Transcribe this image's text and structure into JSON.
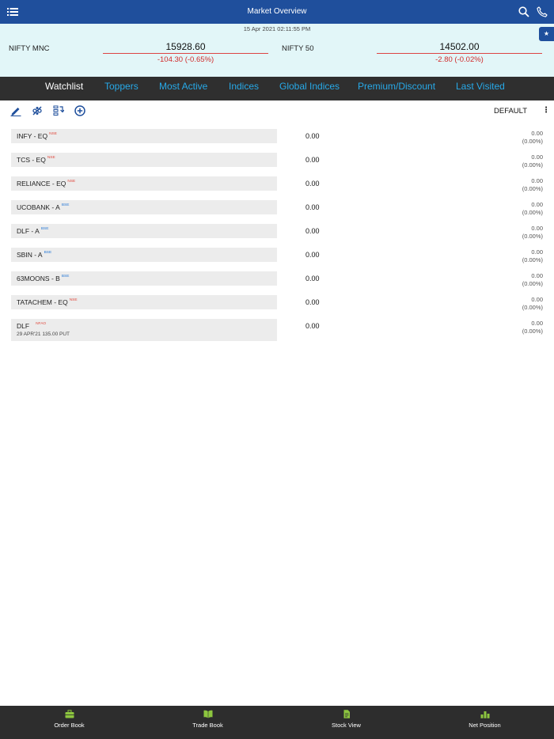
{
  "header": {
    "title": "Market Overview",
    "menu_icon": "hamburger-menu-icon",
    "search_icon": "search-icon",
    "phone_icon": "phone-icon"
  },
  "market": {
    "timestamp": "15 Apr 2021 02:11:55 PM",
    "indices": [
      {
        "name": "NIFTY MNC",
        "value": "15928.60",
        "change": "-104.30 (-0.65%)"
      },
      {
        "name": "NIFTY 50",
        "value": "14502.00",
        "change": "-2.80 (-0.02%)"
      }
    ],
    "favorite_icon": "star-icon"
  },
  "tabs": [
    {
      "label": "Watchlist",
      "active": true
    },
    {
      "label": "Toppers",
      "active": false
    },
    {
      "label": "Most Active",
      "active": false
    },
    {
      "label": "Indices",
      "active": false
    },
    {
      "label": "Global Indices",
      "active": false
    },
    {
      "label": "Premium/Discount",
      "active": false
    },
    {
      "label": "Last Visited",
      "active": false
    }
  ],
  "toolbar": {
    "icons": [
      "edit-icon",
      "reorder-icon",
      "sort-icon",
      "add-circle-icon"
    ],
    "watchlist_name": "DEFAULT",
    "more_icon": "kebab-menu-icon"
  },
  "watchlist": [
    {
      "symbol": "INFY",
      "series": " - EQ",
      "exchange": "NSE",
      "ltp": "0.00",
      "change": "0.00",
      "change_pct": "(0.00%)"
    },
    {
      "symbol": "TCS",
      "series": " - EQ",
      "exchange": "NSE",
      "ltp": "0.00",
      "change": "0.00",
      "change_pct": "(0.00%)"
    },
    {
      "symbol": "RELIANCE",
      "series": " - EQ",
      "exchange": "NSE",
      "ltp": "0.00",
      "change": "0.00",
      "change_pct": "(0.00%)"
    },
    {
      "symbol": "UCOBANK",
      "series": " - A",
      "exchange": "BSE",
      "ltp": "0.00",
      "change": "0.00",
      "change_pct": "(0.00%)"
    },
    {
      "symbol": "DLF",
      "series": " - A",
      "exchange": "BSE",
      "ltp": "0.00",
      "change": "0.00",
      "change_pct": "(0.00%)"
    },
    {
      "symbol": "SBIN",
      "series": " - A",
      "exchange": "BSE",
      "ltp": "0.00",
      "change": "0.00",
      "change_pct": "(0.00%)"
    },
    {
      "symbol": "63MOONS",
      "series": " - B",
      "exchange": "BSE",
      "ltp": "0.00",
      "change": "0.00",
      "change_pct": "(0.00%)"
    },
    {
      "symbol": "TATACHEM",
      "series": " - EQ",
      "exchange": "NSE",
      "ltp": "0.00",
      "change": "0.00",
      "change_pct": "(0.00%)"
    },
    {
      "symbol": "DLF",
      "series": "",
      "exchange": "NFAO",
      "contract": "29 APR'21 135.00 PUT",
      "ltp": "0.00",
      "change": "0.00",
      "change_pct": "(0.00%)"
    }
  ],
  "bottom_nav": [
    {
      "label": "Order Book",
      "icon": "briefcase-icon"
    },
    {
      "label": "Trade Book",
      "icon": "book-icon"
    },
    {
      "label": "Stock View",
      "icon": "document-icon"
    },
    {
      "label": "Net Position",
      "icon": "bar-chart-icon"
    }
  ],
  "colors": {
    "header_bg": "#1f4f9c",
    "ticker_bg": "#e2f6f8",
    "tabbar_bg": "#2f2f2f",
    "tab_inactive": "#27a9e8",
    "negative": "#d12c2c",
    "nav_icon": "#8dc63f"
  }
}
